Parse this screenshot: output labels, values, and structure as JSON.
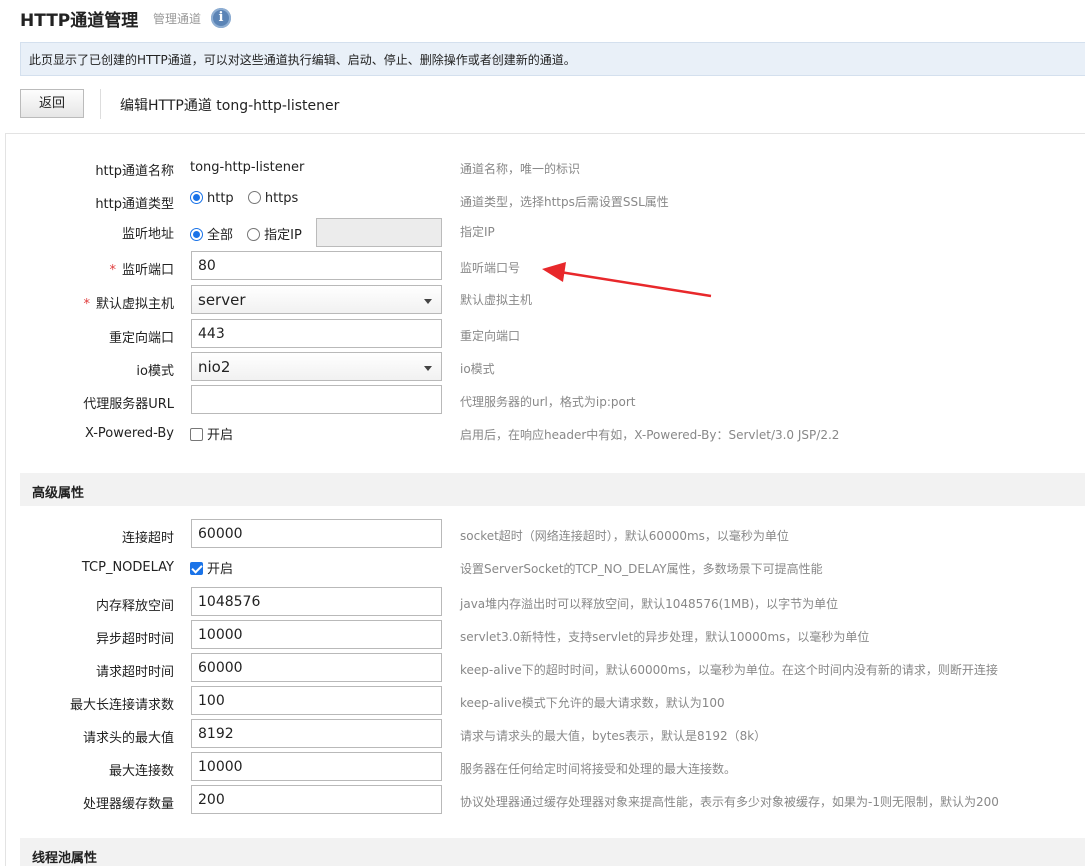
{
  "header": {
    "title": "HTTP通道管理",
    "subtitle": "管理通道",
    "info_glyph": "i"
  },
  "info_bar": {
    "text": "此页显示了已创建的HTTP通道，可以对这些通道执行编辑、启动、停止、删除操作或者创建新的通道。"
  },
  "toolbar": {
    "back_label": "返回",
    "edit_title": "编辑HTTP通道 tong-http-listener"
  },
  "form": {
    "name": {
      "label": "http通道名称",
      "value": "tong-http-listener",
      "hint": "通道名称，唯一的标识"
    },
    "type": {
      "label": "http通道类型",
      "options": [
        "http",
        "https"
      ],
      "selected": "http",
      "hint": "通道类型，选择https后需设置SSL属性"
    },
    "address": {
      "label": "监听地址",
      "options": [
        "全部",
        "指定IP"
      ],
      "selected": "全部",
      "ip_value": "",
      "hint": "指定IP"
    },
    "port": {
      "required_mark": "*",
      "label": "监听端口",
      "value": "80",
      "hint": "监听端口号"
    },
    "vhost": {
      "required_mark": "*",
      "label": "默认虚拟主机",
      "value": "server",
      "hint": "默认虚拟主机"
    },
    "redirect_port": {
      "label": "重定向端口",
      "value": "443",
      "hint": "重定向端口"
    },
    "io_mode": {
      "label": "io模式",
      "value": "nio2",
      "hint": "io模式"
    },
    "proxy_url": {
      "label": "代理服务器URL",
      "value": "",
      "hint": "代理服务器的url，格式为ip:port"
    },
    "powered_by": {
      "label": "X-Powered-By",
      "checkbox_label": "开启",
      "checked": false,
      "hint": "启用后，在响应header中有如，X-Powered-By：Servlet/3.0 JSP/2.2"
    }
  },
  "advanced": {
    "section_title": "高级属性",
    "conn_timeout": {
      "label": "连接超时",
      "value": "60000",
      "hint": "socket超时（网络连接超时），默认60000ms，以毫秒为单位"
    },
    "tcp_nodelay": {
      "label": "TCP_NODELAY",
      "checkbox_label": "开启",
      "checked": true,
      "hint": "设置ServerSocket的TCP_NO_DELAY属性，多数场景下可提高性能"
    },
    "mem_release": {
      "label": "内存释放空间",
      "value": "1048576",
      "hint": "java堆内存溢出时可以释放空间，默认1048576(1MB)，以字节为单位"
    },
    "async_timeout": {
      "label": "异步超时时间",
      "value": "10000",
      "hint": "servlet3.0新特性，支持servlet的异步处理，默认10000ms，以毫秒为单位"
    },
    "req_timeout": {
      "label": "请求超时时间",
      "value": "60000",
      "hint": "keep-alive下的超时时间，默认60000ms，以毫秒为单位。在这个时间内没有新的请求，则断开连接"
    },
    "max_keepalive": {
      "label": "最大长连接请求数",
      "value": "100",
      "hint": "keep-alive模式下允许的最大请求数，默认为100"
    },
    "max_header": {
      "label": "请求头的最大值",
      "value": "8192",
      "hint": "请求与请求头的最大值，bytes表示，默认是8192（8k）"
    },
    "max_conn": {
      "label": "最大连接数",
      "value": "10000",
      "hint": "服务器在任何给定时间将接受和处理的最大连接数。"
    },
    "proc_cache": {
      "label": "处理器缓存数量",
      "value": "200",
      "hint": "协议处理器通过缓存处理器对象来提高性能，表示有多少对象被缓存，如果为-1则无限制，默认为200"
    }
  },
  "threadpool": {
    "section_title": "线程池属性"
  },
  "colors": {
    "accent": "#1a73e8",
    "required": "#e03b3b",
    "annotation_arrow": "#e8282b"
  }
}
